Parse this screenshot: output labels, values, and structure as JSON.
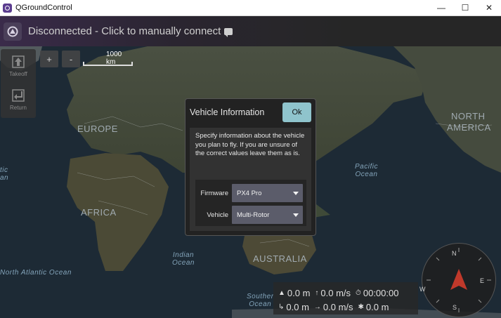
{
  "window": {
    "title": "QGroundControl",
    "controls": {
      "minimize": "—",
      "maximize": "☐",
      "close": "✕"
    }
  },
  "toolbar": {
    "status": "Disconnected - Click to manually connect"
  },
  "left_tools": [
    {
      "label": "Takeoff",
      "icon": "takeoff-icon"
    },
    {
      "label": "Return",
      "icon": "return-icon"
    }
  ],
  "map": {
    "zoom_in": "+",
    "zoom_out": "-",
    "scale_label": "1000 km",
    "labels": {
      "europe": "EUROPE",
      "africa": "AFRICA",
      "north_america_1": "NORTH",
      "north_america_2": "AMERICA",
      "australia": "AUSTRALIA",
      "pacific_1": "Pacific",
      "pacific_2": "Ocean",
      "indian_1": "Indian",
      "indian_2": "Ocean",
      "north_atlantic": "North Atlantic Ocean",
      "southern_1": "Souther",
      "southern_2": "Ocean",
      "atlantic_edge_1": "tic",
      "atlantic_edge_2": "an"
    }
  },
  "dialog": {
    "title": "Vehicle Information",
    "ok_label": "Ok",
    "description": "Specify information about the vehicle you plan to fly. If you are unsure of the correct values leave them as is.",
    "firmware_label": "Firmware",
    "firmware_value": "PX4 Pro",
    "vehicle_label": "Vehicle",
    "vehicle_value": "Multi-Rotor"
  },
  "telemetry": {
    "altitude": "0.0 m",
    "vertical_speed": "0.0 m/s",
    "flight_time": "00:00:00",
    "distance": "0.0 m",
    "horizontal_speed": "0.0 m/s",
    "home_distance": "0.0 m"
  },
  "compass": {
    "n": "N",
    "e": "E",
    "s": "S",
    "w": "W"
  },
  "colors": {
    "accent": "#8fc4cc",
    "toolbar": "#2a2530",
    "heading": "#c0392b"
  }
}
